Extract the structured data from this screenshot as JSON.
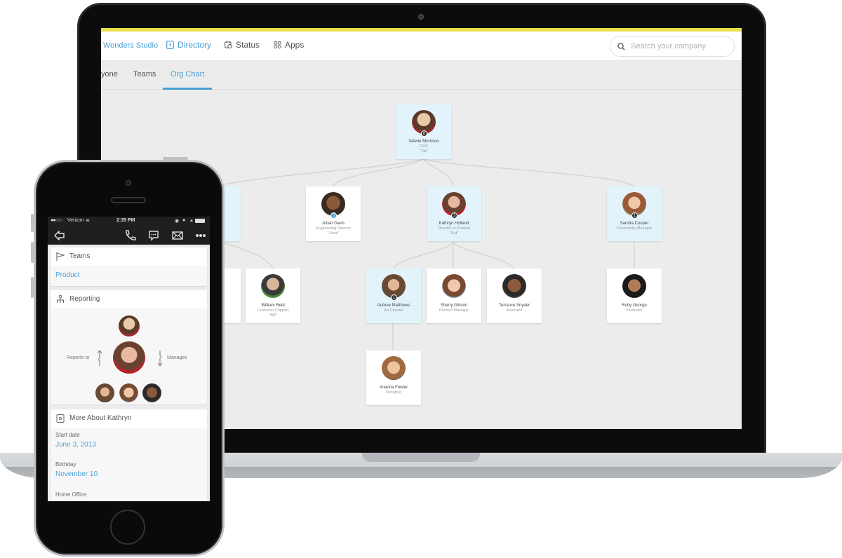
{
  "desktop": {
    "brand": "Wonders Studio",
    "nav": [
      {
        "label": "Directory",
        "icon": "directory-icon",
        "active": true
      },
      {
        "label": "Status",
        "icon": "status-icon",
        "active": false
      },
      {
        "label": "Apps",
        "icon": "apps-icon",
        "active": false
      }
    ],
    "search": {
      "placeholder": "Search your company",
      "value": ""
    },
    "subtabs": [
      {
        "label": "yone",
        "active": false
      },
      {
        "label": "Teams",
        "active": false
      },
      {
        "label": "Org Chart",
        "active": true
      }
    ],
    "accent_color": "#4a9fd6",
    "top_bar_color": "#e8e04a",
    "org_chart": {
      "ceo": {
        "name": "Valerie Morrison",
        "title": "CEO",
        "nickname": "\"Val\"",
        "badge": "8",
        "highlighted": true
      },
      "level2": [
        {
          "name": "",
          "title": "",
          "nickname": "",
          "highlighted": true,
          "partial": true
        },
        {
          "name": "Julian Davis",
          "title": "Engineering Director",
          "nickname": "\"Jules\"",
          "badge": "5",
          "badge_color": "blue",
          "highlighted": false
        },
        {
          "name": "Kathryn Holland",
          "title": "Director of Product",
          "nickname": "\"Kat\"",
          "badge": "3",
          "highlighted": true
        },
        {
          "name": "Sandra Cooper",
          "title": "Community Manager",
          "nickname": "",
          "badge": "1",
          "highlighted": true
        }
      ],
      "level3": [
        {
          "name": "",
          "title": "",
          "nickname": "",
          "highlighted": false,
          "partial": true
        },
        {
          "name": "William Reid",
          "title": "Customer Support",
          "nickname": "\"Bill\"",
          "highlighted": false
        },
        {
          "name": "Aubree Matthews",
          "title": "Art Director",
          "nickname": "",
          "badge": "1",
          "highlighted": true
        },
        {
          "name": "Sherry Gibson",
          "title": "Product Manager",
          "nickname": "",
          "highlighted": false
        },
        {
          "name": "Terrance Snyder",
          "title": "Illustrator",
          "nickname": "",
          "highlighted": false
        },
        {
          "name": "Ruby George",
          "title": "Illustrator",
          "nickname": "",
          "highlighted": false
        }
      ],
      "level4": [
        {
          "name": "Arianna Fowler",
          "title": "Designer",
          "nickname": "",
          "highlighted": false
        }
      ]
    }
  },
  "mobile": {
    "status_bar": {
      "carrier": "Verizon",
      "time": "2:35 PM"
    },
    "actions": [
      "back-icon",
      "phone-icon",
      "chat-icon",
      "mail-icon",
      "more-icon"
    ],
    "teams": {
      "heading": "Teams",
      "value": "Product"
    },
    "reporting": {
      "heading": "Reporting",
      "reports_to_label": "Reports to",
      "manages_label": "Manages"
    },
    "more_about": {
      "heading": "More About Kathryn",
      "fields": [
        {
          "label": "Start date",
          "value": "June 3, 2013"
        },
        {
          "label": "Birthday",
          "value": "November 10"
        },
        {
          "label": "Home Office",
          "value": ""
        }
      ]
    }
  }
}
